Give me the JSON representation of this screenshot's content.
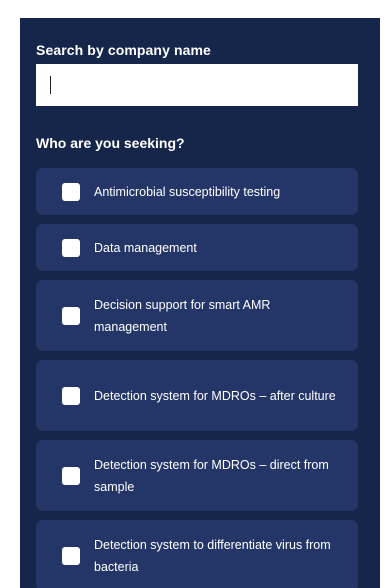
{
  "search": {
    "label": "Search by company name",
    "value": "",
    "placeholder": ""
  },
  "seeking": {
    "label": "Who are you seeking?"
  },
  "options": [
    {
      "label": "Antimicrobial susceptibility testing",
      "checked": false
    },
    {
      "label": "Data management",
      "checked": false
    },
    {
      "label": "Decision support for smart AMR management",
      "checked": false
    },
    {
      "label": "Detection system for MDROs – after culture",
      "checked": false
    },
    {
      "label": "Detection system for MDROs – direct from sample",
      "checked": false
    },
    {
      "label": "Detection system to differentiate virus from bacteria",
      "checked": false
    }
  ],
  "colors": {
    "panel_bg": "#16254a",
    "option_bg": "#243667",
    "text": "#ffffff"
  }
}
